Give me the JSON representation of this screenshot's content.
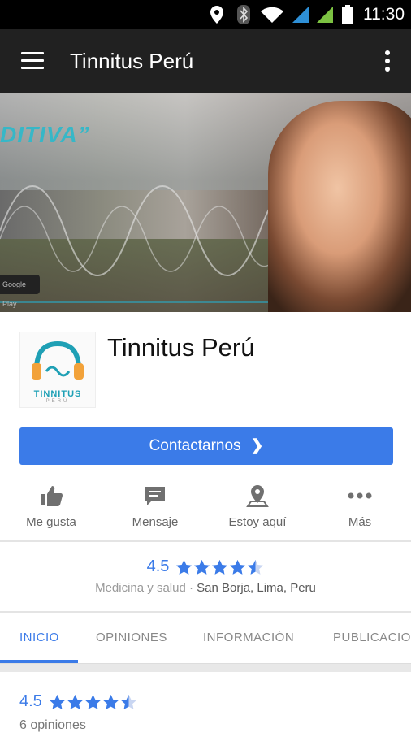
{
  "status_bar": {
    "time": "11:30"
  },
  "app_bar": {
    "title": "Tinnitus Perú"
  },
  "cover": {
    "brand_text": "DITIVA”",
    "badge_text": "Google Play"
  },
  "profile": {
    "name": "Tinnitus Perú",
    "logo_text": "TINNITUS",
    "logo_sub": "PERÚ",
    "cta_label": "Contactarnos"
  },
  "actions": [
    {
      "label": "Me gusta",
      "icon": "thumbs-up-icon"
    },
    {
      "label": "Mensaje",
      "icon": "message-icon"
    },
    {
      "label": "Estoy aquí",
      "icon": "map-pin-icon"
    },
    {
      "label": "Más",
      "icon": "more-dots-icon"
    }
  ],
  "rating": {
    "value": "4.5",
    "stars": 4.5,
    "category": "Medicina y salud",
    "separator": " · ",
    "location": "San Borja, Lima, Peru"
  },
  "tabs": [
    {
      "label": "INICIO",
      "active": true
    },
    {
      "label": "OPINIONES",
      "active": false
    },
    {
      "label": "INFORMACIÓN",
      "active": false
    },
    {
      "label": "PUBLICACIO",
      "active": false
    }
  ],
  "reviews": {
    "value": "4.5",
    "stars": 4.5,
    "count_text": "6 opiniones"
  },
  "colors": {
    "accent": "#3b7be8",
    "app_bar": "#212121",
    "status_bar": "#000000"
  }
}
